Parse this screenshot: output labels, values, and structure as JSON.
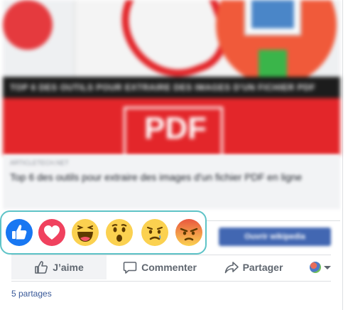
{
  "preview": {
    "banner_text": "TOP 6 DES OUTILS POUR EXTRAIRE DES IMAGES D'UN FICHIER PDF",
    "big_text": "PDF",
    "source": "ARTICLETECH.NET",
    "headline": "Top 6 des outils pour extraire des images d'un fichier PDF en ligne"
  },
  "cta": {
    "label": "Ouvrir wikipedia"
  },
  "reactions": [
    {
      "name": "like",
      "icon": "thumbs-up-icon"
    },
    {
      "name": "love",
      "icon": "heart-icon"
    },
    {
      "name": "haha",
      "icon": "laughing-face-icon"
    },
    {
      "name": "wow",
      "icon": "surprised-face-icon"
    },
    {
      "name": "sad",
      "icon": "sad-face-icon"
    },
    {
      "name": "angry",
      "icon": "angry-face-icon"
    }
  ],
  "actions": {
    "like_label": "J’aime",
    "comment_label": "Commenter",
    "share_label": "Partager"
  },
  "shares": {
    "text": "5 partages"
  },
  "colors": {
    "accent_teal": "#5ec3c7",
    "fb_blue": "#4267b2",
    "like_blue": "#1877f2",
    "love_red": "#f0415e",
    "emoji_yellow": "#fbd150",
    "angry_orange": "#e9573f"
  }
}
